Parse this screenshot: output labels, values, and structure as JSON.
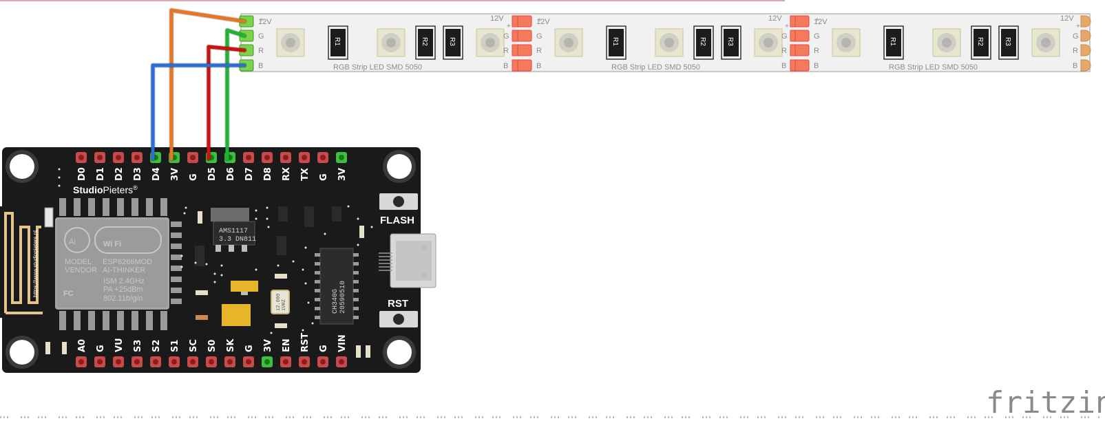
{
  "board": {
    "brand_bold": "Studio",
    "brand_light": "Pieters",
    "brand_reg": "®",
    "url": "https://www.studiopieters.nl",
    "top_pins": [
      "D0",
      "D1",
      "D2",
      "D3",
      "D4",
      "3V",
      "G",
      "D5",
      "D6",
      "D7",
      "D8",
      "RX",
      "TX",
      "G",
      "3V"
    ],
    "bottom_pins": [
      "A0",
      "G",
      "VU",
      "S3",
      "S2",
      "S1",
      "SC",
      "S0",
      "SK",
      "G",
      "3V",
      "EN",
      "RST",
      "G",
      "VIN"
    ],
    "flash_label": "FLASH",
    "rst_label": "RST",
    "regulator": [
      "AMS1117",
      "3.3 DN811"
    ],
    "usb_chip": [
      "CH340G",
      "20590510"
    ],
    "crystal": [
      "12.000",
      "1VHZ"
    ],
    "module": {
      "wifi": "Wi Fi",
      "lines": [
        "MODEL",
        "VENDOR"
      ],
      "values": [
        "ESP8266MOD",
        "AI-THINKER"
      ],
      "ism": [
        "ISM   2.4GHz",
        "PA   +25dBm",
        "802.11b/g/n"
      ]
    }
  },
  "strip": {
    "label": "RGB Strip LED SMD 5050",
    "pads": [
      "12V",
      "G",
      "R",
      "B"
    ],
    "plus": "+",
    "resistors": [
      "R1",
      "R2",
      "R3"
    ]
  },
  "wires": [
    {
      "from": "3V",
      "to": "12V",
      "color": "#e87722"
    },
    {
      "from": "D6",
      "to": "G",
      "color": "#1fb336"
    },
    {
      "from": "D5",
      "to": "R",
      "color": "#cc1111"
    },
    {
      "from": "D4",
      "to": "B",
      "color": "#2b6fd6"
    }
  ],
  "logo": "fritzing"
}
